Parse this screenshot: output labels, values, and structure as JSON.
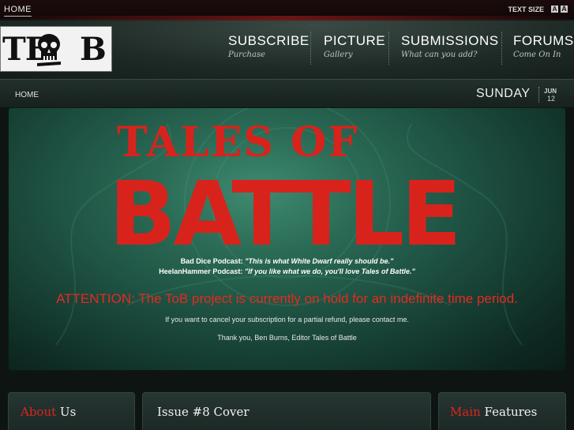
{
  "topbar": {
    "home_label": "HOME",
    "text_size_label": "TEXT SIZE",
    "size_small": "A",
    "size_large": "A"
  },
  "logo": {
    "text_left": "TE",
    "text_right": "B"
  },
  "nav": [
    {
      "title": "SUBSCRIBE",
      "sub": "Purchase"
    },
    {
      "title": "PICTURE",
      "sub": "Gallery"
    },
    {
      "title": "SUBMISSIONS",
      "sub": "What can you add?"
    },
    {
      "title": "FORUMS",
      "sub": "Come On In"
    }
  ],
  "breadcrumb": {
    "label": "HOME"
  },
  "date": {
    "day": "SUNDAY",
    "month": "JUN",
    "date": "12"
  },
  "hero": {
    "logo_line1": "TALES OF",
    "logo_line2": "BATTLE",
    "quote1_source": "Bad Dice Podcast: ",
    "quote1_text": "\"This is what White Dwarf really should be.\"",
    "quote2_source": "HeelanHammer Podcast: ",
    "quote2_text": "\"If you like what we do, you'll love Tales of Battle.\"",
    "attention": "ATTENTION: The ToB project is currently on hold for an indefinite time period.",
    "refund_note": "If you want to cancel your subscription for a partial refund, please contact me.",
    "signoff": "Thank you, Ben Burns, Editor Tales of Battle"
  },
  "panels": {
    "about_red": "About",
    "about_white": " Us",
    "issue": "Issue #8 Cover",
    "main_red": "Main",
    "main_white": " Features"
  },
  "colors": {
    "accent_red": "#d9271d",
    "background": "#0d1412"
  }
}
